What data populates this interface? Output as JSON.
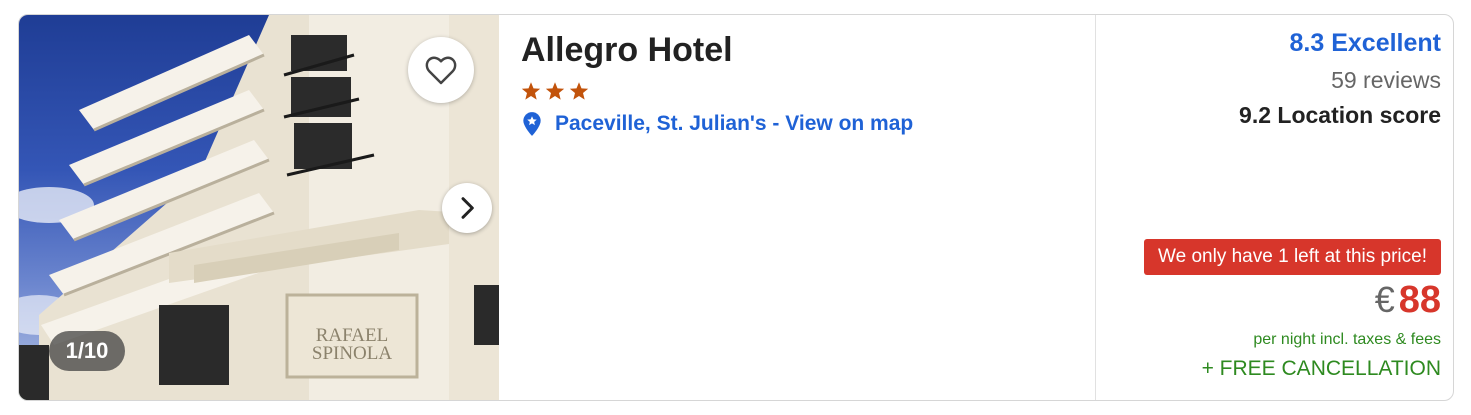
{
  "photo": {
    "counter": "1/10",
    "favorite_icon": "heart-outline-icon",
    "next_icon": "chevron-right-icon",
    "sign_line1": "RAFAEL",
    "sign_line2": "SPINOLA"
  },
  "hotel": {
    "name": "Allegro Hotel",
    "star_rating": 3,
    "star_color": "#c2530b",
    "location_icon": "map-pin-icon",
    "location": "Paceville, St. Julian's - View on map"
  },
  "score": {
    "rating": "8.3 Excellent",
    "reviews": "59 reviews",
    "location_score": "9.2 Location score"
  },
  "offer": {
    "urgency": "We only have 1 left at this price!",
    "currency": "€",
    "price": "88",
    "per_night": "per night incl. taxes & fees",
    "free_cancellation": "+ FREE CANCELLATION"
  },
  "colors": {
    "link": "#1f62d6",
    "urgency_bg": "#d7362b",
    "price": "#d7362b",
    "positive": "#2e8a20"
  }
}
